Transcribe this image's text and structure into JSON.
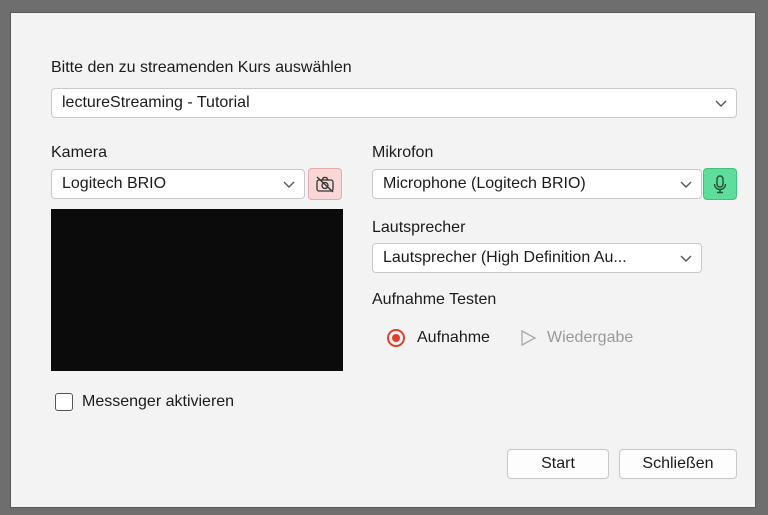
{
  "course": {
    "label": "Bitte den zu streamenden Kurs auswählen",
    "selected": "lectureStreaming - Tutorial"
  },
  "camera": {
    "label": "Kamera",
    "selected": "Logitech BRIO",
    "toggle_icon": "camera-off-icon"
  },
  "microphone": {
    "label": "Mikrofon",
    "selected": "Microphone (Logitech BRIO)",
    "toggle_icon": "microphone-icon"
  },
  "speaker": {
    "label": "Lautsprecher",
    "selected": "Lautsprecher (High Definition Au..."
  },
  "test": {
    "label": "Aufnahme Testen",
    "record_label": "Aufnahme",
    "playback_label": "Wiedergabe"
  },
  "messenger": {
    "label": "Messenger aktivieren",
    "checked": false
  },
  "buttons": {
    "start": "Start",
    "close": "Schließen"
  },
  "colors": {
    "accent": "#e0402a",
    "mic_active": "#5fdd9a",
    "camera_off": "#f9d7d7"
  }
}
